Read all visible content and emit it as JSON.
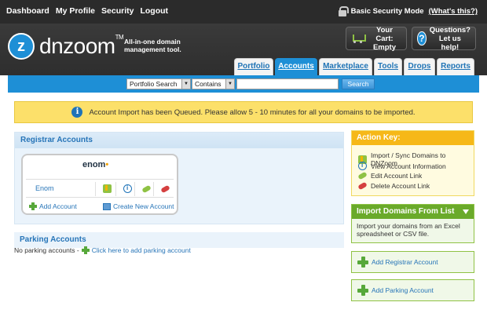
{
  "topnav": {
    "items": [
      "Dashboard",
      "My Profile",
      "Security",
      "Logout"
    ],
    "security_mode": "Basic Security Mode",
    "whats_this": "(What's this?)"
  },
  "header": {
    "logo_letter": "z",
    "brand": "dnzoom",
    "tm": "TM",
    "tagline_line1": "All-in-one domain",
    "tagline_line2": "management tool.",
    "cart_line1": "Your Cart:",
    "cart_line2": "Empty",
    "help_line1": "Questions?",
    "help_line2": "Let us help!"
  },
  "tabs": [
    {
      "label": "Portfolio",
      "active": false
    },
    {
      "label": "Accounts",
      "active": true
    },
    {
      "label": "Marketplace",
      "active": false
    },
    {
      "label": "Tools",
      "active": false
    },
    {
      "label": "Drops",
      "active": false
    },
    {
      "label": "Reports",
      "active": false
    }
  ],
  "search": {
    "scope_selected": "Portfolio Search",
    "match_selected": "Contains",
    "query": "",
    "button_label": "Search"
  },
  "notice": {
    "text": "Account Import has been Queued. Please allow 5 - 10 minutes for all your domains to be imported."
  },
  "registrar": {
    "title": "Registrar Accounts",
    "logo": "enom",
    "account_name": "Enom",
    "add_account": "Add Account",
    "create_account": "Create New Account"
  },
  "parking": {
    "title": "Parking Accounts",
    "empty_text": "No parking accounts -",
    "add_link": "Click here to add parking account"
  },
  "action_key": {
    "title": "Action Key:",
    "items": [
      "Import / Sync Domains to DNZoom",
      "View Account Information",
      "Edit Account Link",
      "Delete Account Link"
    ]
  },
  "import": {
    "title": "Import Domains From List",
    "text": "Import your domains from an Excel spreadsheet or CSV file."
  },
  "buttons": {
    "add_registrar": "Add Registrar Account",
    "add_parking": "Add Parking Account"
  },
  "colors": {
    "primary_blue": "#1e8fd6",
    "link_blue": "#2775b8",
    "notice_yellow": "#fce06a",
    "action_orange": "#f6b818",
    "green": "#6aaa2a"
  }
}
